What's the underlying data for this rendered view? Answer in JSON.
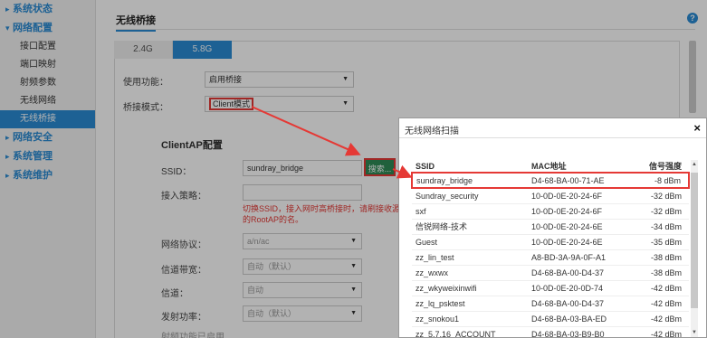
{
  "sidebar": {
    "groups": [
      {
        "label": "系统状态",
        "chevron": "▸"
      },
      {
        "label": "网络配置",
        "chevron": "▾"
      },
      {
        "label": "网络安全",
        "chevron": "▸"
      },
      {
        "label": "系统管理",
        "chevron": "▸"
      },
      {
        "label": "系统维护",
        "chevron": "▸"
      }
    ],
    "items": [
      {
        "label": "接口配置"
      },
      {
        "label": "端口映射"
      },
      {
        "label": "射频参数"
      },
      {
        "label": "无线网络"
      },
      {
        "label": "无线桥接"
      }
    ]
  },
  "main": {
    "title": "无线桥接",
    "help_icon": "?",
    "tabs": [
      {
        "label": "2.4G"
      },
      {
        "label": "5.8G"
      }
    ],
    "form": {
      "enable_label": "使用功能：",
      "enable_value": "启用桥接",
      "mode_label": "桥接模式：",
      "mode_value": "Client模式",
      "section_title": "ClientAP配置",
      "ssid_label": "SSID：",
      "ssid_value": "sundray_bridge",
      "scan_button": "搜索...",
      "access_label": "接入策略：",
      "hint": "切换SSID，接入网时高桥接时，请刷接收源的RootAP的名。",
      "protocol_label": "网络协议：",
      "protocol_value": "a/n/ac",
      "channel_width_label": "信道带宽：",
      "channel_width_value": "自动（默认）",
      "channel_label": "信道：",
      "channel_value": "自动",
      "power_label": "发射功率：",
      "power_value": "自动（默认）",
      "footer_text": "射频功能已启用..."
    }
  },
  "modal": {
    "title": "无线网络扫描",
    "close": "×",
    "columns": [
      "SSID",
      "MAC地址",
      "信号强度"
    ],
    "rows": [
      [
        "sundray_bridge",
        "D4-68-BA-00-71-AE",
        "-8 dBm"
      ],
      [
        "Sundray_security",
        "10-0D-0E-20-24-6F",
        "-32 dBm"
      ],
      [
        "sxf",
        "10-0D-0E-20-24-6F",
        "-32 dBm"
      ],
      [
        "信锐网络-技术",
        "10-0D-0E-20-24-6E",
        "-34 dBm"
      ],
      [
        "Guest",
        "10-0D-0E-20-24-6E",
        "-35 dBm"
      ],
      [
        "zz_lin_test",
        "A8-BD-3A-9A-0F-A1",
        "-38 dBm"
      ],
      [
        "zz_wxwx",
        "D4-68-BA-00-D4-37",
        "-38 dBm"
      ],
      [
        "zz_wkyweixinwifi",
        "10-0D-0E-20-0D-74",
        "-42 dBm"
      ],
      [
        "zz_lq_psktest",
        "D4-68-BA-00-D4-37",
        "-42 dBm"
      ],
      [
        "zz_snokou1",
        "D4-68-BA-03-BA-ED",
        "-42 dBm"
      ],
      [
        "zz_5.7.16_ACCOUNT",
        "D4-68-BA-03-B9-B0",
        "-42 dBm"
      ]
    ],
    "selected_row_index": 0
  },
  "colors": {
    "accent": "#2a8bd4",
    "highlight": "#e53935",
    "scan_button": "#2e8b57"
  }
}
